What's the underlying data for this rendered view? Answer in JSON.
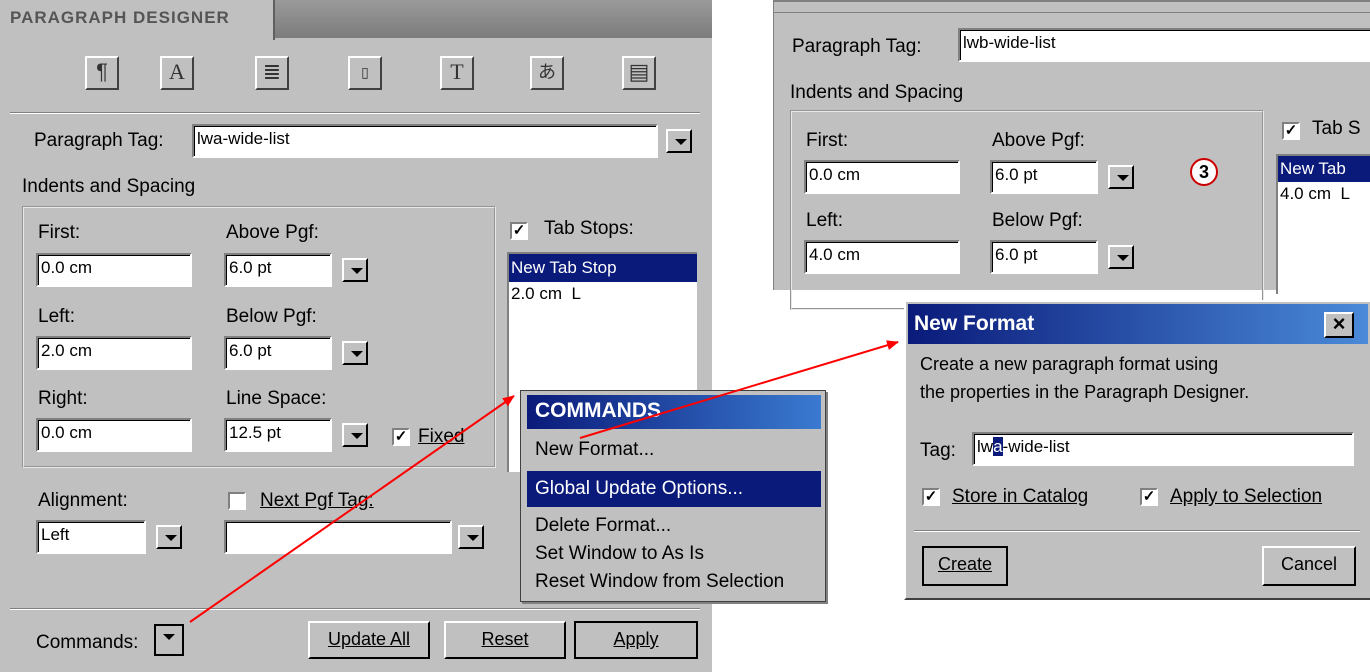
{
  "designer": {
    "title": "PARAGRAPH DESIGNER",
    "icons": [
      "pilcrow-icon",
      "font-a-icon",
      "text-lines-icon",
      "page-number-icon",
      "text-frame-icon",
      "asian-text-icon",
      "table-cell-icon"
    ],
    "para_tag_label": "Paragraph Tag:",
    "para_tag_value": "lwa-wide-list",
    "indents_label": "Indents and Spacing",
    "first_label": "First:",
    "first_value": "0.0 cm",
    "left_label": "Left:",
    "left_value": "2.0 cm",
    "right_label": "Right:",
    "right_value": "0.0 cm",
    "above_label": "Above Pgf:",
    "above_value": "6.0 pt",
    "below_label": "Below Pgf:",
    "below_value": "6.0 pt",
    "linespace_label": "Line Space:",
    "linespace_value": "12.5 pt",
    "fixed_label": "Fixed",
    "fixed_checked": "✓",
    "tabstops_label": "Tab Stops:",
    "tabstops_checked": "✓",
    "tabstops_items": [
      "New Tab Stop",
      "2.0 cm  L"
    ],
    "alignment_label": "Alignment:",
    "alignment_value": "Left",
    "nextpgf_label": "Next Pgf Tag:",
    "nextpgf_value": "",
    "commands_label": "Commands:",
    "update_all": "Update All",
    "reset": "Reset",
    "apply": "Apply"
  },
  "commands_menu": {
    "header": "COMMANDS",
    "items": [
      "New Format...",
      "Global Update Options...",
      "Delete Format...",
      "Set Window to As Is",
      "Reset Window from Selection"
    ]
  },
  "designer2": {
    "para_tag_label": "Paragraph Tag:",
    "para_tag_value": "lwb-wide-list",
    "indents_label": "Indents and Spacing",
    "first_label": "First:",
    "first_value": "0.0 cm",
    "left_label": "Left:",
    "left_value": "4.0 cm",
    "above_label": "Above Pgf:",
    "above_value": "6.0 pt",
    "below_label": "Below Pgf:",
    "below_value": "6.0 pt",
    "step_badge": "3",
    "tabstops_label": "Tab S",
    "tabstops_checked": "✓",
    "tabstops_items": [
      "New Tab",
      "4.0 cm  L"
    ]
  },
  "new_format": {
    "title": "New Format",
    "close": "×",
    "message_line1": "Create a new paragraph format using",
    "message_line2": "the properties in the Paragraph Designer.",
    "tag_label": "Tag:",
    "tag_value_pre": "lw",
    "tag_value_sel": "a",
    "tag_value_post": "-wide-list",
    "store_label": "Store in Catalog",
    "store_checked": "✓",
    "apply_sel_label": "Apply to Selection",
    "apply_sel_checked": "✓",
    "create": "Create",
    "cancel": "Cancel"
  },
  "colors": {
    "menu_highlight": "#0a1a7a",
    "arrow": "#ff0000",
    "panel": "#c0c0c0"
  }
}
